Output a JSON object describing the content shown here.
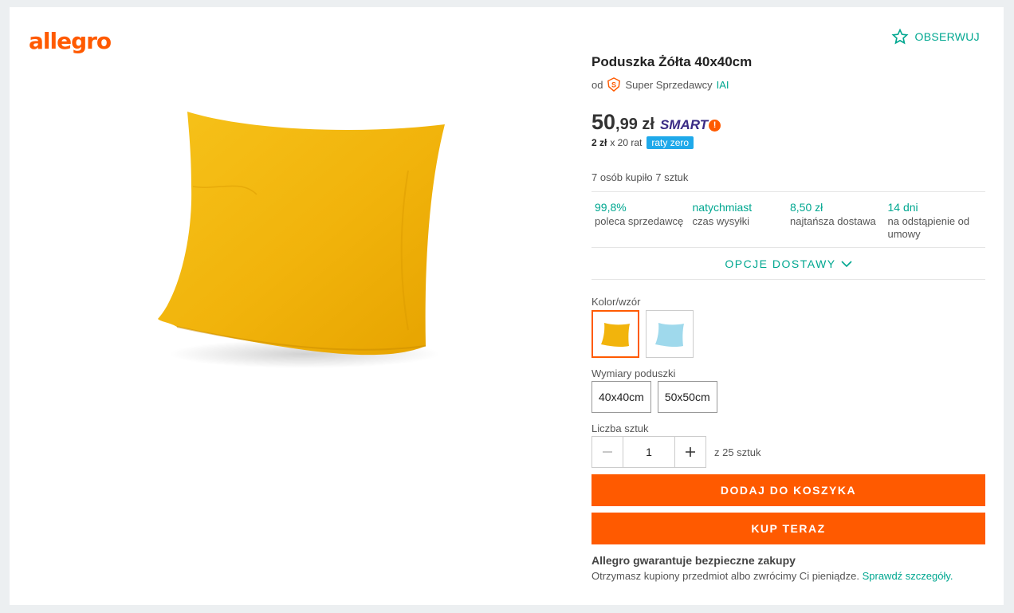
{
  "brand": {
    "logo": "allegro",
    "accent": "#ff5a00",
    "link": "#00a790"
  },
  "watch": {
    "label": "OBSERWUJ",
    "icon": "star-outline-icon"
  },
  "product": {
    "title": "Poduszka Żółta 40x40cm",
    "seller_prefix": "od",
    "seller_badge": "super-seller-icon",
    "seller_label": "Super Sprzedawcy",
    "seller_name": "IAI",
    "image": "yellow-pillow-photo"
  },
  "price": {
    "main": "50",
    "cents": ",99 zł",
    "smart": "SMART",
    "installment_amount": "2 zł",
    "installment_count": "x 20 rat",
    "installment_badge": "raty zero"
  },
  "bought": "7 osób kupiło 7 sztuk",
  "stats": [
    {
      "value": "99,8%",
      "label": "poleca sprzedawcę"
    },
    {
      "value": "natychmiast",
      "label": "czas wysyłki"
    },
    {
      "value": "8,50 zł",
      "label": "najtańsza dostawa"
    },
    {
      "value": "14 dni",
      "label": "na odstąpienie od umowy"
    }
  ],
  "delivery_options": "OPCJE DOSTAWY",
  "color": {
    "label": "Kolor/wzór",
    "options": [
      {
        "name": "yellow",
        "color": "#f4b60e",
        "selected": true
      },
      {
        "name": "light-blue",
        "color": "#9ed8ea",
        "selected": false
      }
    ]
  },
  "dimensions": {
    "label": "Wymiary poduszki",
    "options": [
      "40x40cm",
      "50x50cm"
    ]
  },
  "quantity": {
    "label": "Liczba sztuk",
    "value": "1",
    "of": "z 25 sztuk"
  },
  "actions": {
    "add_to_cart": "DODAJ DO KOSZYKA",
    "buy_now": "KUP TERAZ"
  },
  "guarantee": {
    "title": "Allegro gwarantuje bezpieczne zakupy",
    "text": "Otrzymasz kupiony przedmiot albo zwrócimy Ci pieniądze.",
    "link": "Sprawdź szczegóły."
  }
}
